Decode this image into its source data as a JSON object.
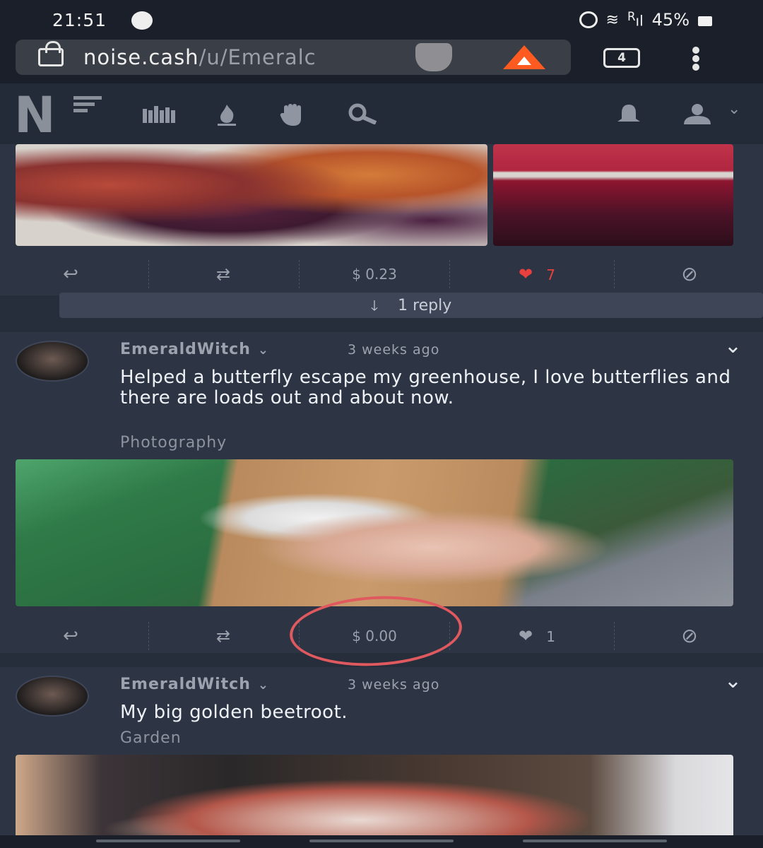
{
  "status_bar": {
    "time": "21:51",
    "signal_label": "R",
    "battery": "45%",
    "icons": [
      "brave-icon",
      "alarm-icon",
      "wifi-icon",
      "signal-icon",
      "battery-icon"
    ]
  },
  "browser": {
    "url_domain": "noise.cash",
    "url_path": "/u/Emeralc",
    "tabs_count": "4",
    "icons": [
      "lock-icon",
      "brave-shield-icon",
      "bat-rewards-icon",
      "menu-dots-icon"
    ]
  },
  "app_nav": {
    "logo_letter": "N",
    "icons": [
      "library-icon",
      "fire-icon",
      "hand-icon",
      "search-icon",
      "bell-icon",
      "user-icon",
      "chevron-down-icon"
    ]
  },
  "previous_post": {
    "tip_amount": "$ 0.23",
    "likes": "7",
    "liked": true,
    "reply_label": "1 reply",
    "photo_left": "purple and golden beetroots",
    "photo_right": "beetroot juice in glass"
  },
  "posts": [
    {
      "author": "EmeraldWitch",
      "time": "3 weeks ago",
      "text": "Helped a butterfly escape my greenhouse, I love butterflies and there are loads out and about now.",
      "tag": "Photography",
      "tip_amount": "$ 0.00",
      "likes": "1",
      "photo": "butterfly on hand"
    },
    {
      "author": "EmeraldWitch",
      "time": "3 weeks ago",
      "text": "My big golden beetroot.",
      "tag": "Garden",
      "photo": "golden beetroot held in hand"
    }
  ],
  "colors": {
    "background": "#262d3b",
    "card": "#2d3545",
    "liked_red": "#e8403c",
    "annotation_red": "#e0595f"
  }
}
